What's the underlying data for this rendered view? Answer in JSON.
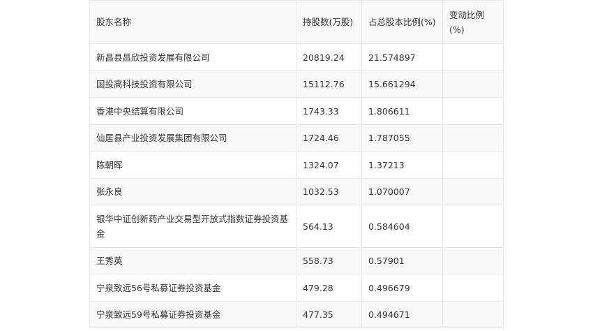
{
  "table": {
    "headers": [
      "股东名称",
      "持股数(万股)",
      "占总股本比例(%)",
      "变动比例(%)"
    ],
    "rows": [
      {
        "name": "新昌县昌欣投资发展有限公司",
        "shares": "20819.24",
        "ratio": "21.574897",
        "change": ""
      },
      {
        "name": "国投高科技投资有限公司",
        "shares": "15112.76",
        "ratio": "15.661294",
        "change": ""
      },
      {
        "name": "香港中央结算有限公司",
        "shares": "1743.33",
        "ratio": "1.806611",
        "change": ""
      },
      {
        "name": "仙居县产业投资发展集团有限公司",
        "shares": "1724.46",
        "ratio": "1.787055",
        "change": ""
      },
      {
        "name": "陈朝晖",
        "shares": "1324.07",
        "ratio": "1.37213",
        "change": ""
      },
      {
        "name": "张永良",
        "shares": "1032.53",
        "ratio": "1.070007",
        "change": ""
      },
      {
        "name": "银华中证创新药产业交易型开放式指数证券投资基金",
        "shares": "564.13",
        "ratio": "0.584604",
        "change": ""
      },
      {
        "name": "王秀英",
        "shares": "558.73",
        "ratio": "0.57901",
        "change": ""
      },
      {
        "name": "宁泉致远56号私募证券投资基金",
        "shares": "479.28",
        "ratio": "0.496679",
        "change": ""
      },
      {
        "name": "宁泉致远59号私募证券投资基金",
        "shares": "477.35",
        "ratio": "0.494671",
        "change": ""
      }
    ]
  }
}
